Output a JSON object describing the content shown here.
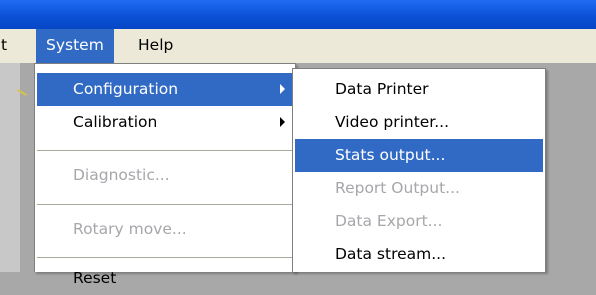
{
  "menubar": {
    "items": [
      {
        "label": "t"
      },
      {
        "label": "System"
      },
      {
        "label": "Help"
      }
    ]
  },
  "system_menu": {
    "items": [
      {
        "label": "Configuration",
        "has_submenu": true,
        "state": "highlighted"
      },
      {
        "label": "Calibration",
        "has_submenu": true,
        "state": "normal"
      },
      {
        "label": "Diagnostic...",
        "state": "disabled"
      },
      {
        "label": "Rotary move...",
        "state": "disabled"
      },
      {
        "label": "Reset",
        "state": "normal"
      }
    ]
  },
  "configuration_submenu": {
    "items": [
      {
        "label": "Data Printer",
        "state": "normal"
      },
      {
        "label": "Video printer...",
        "state": "normal"
      },
      {
        "label": "Stats output...",
        "state": "highlighted"
      },
      {
        "label": "Report Output...",
        "state": "disabled"
      },
      {
        "label": "Data Export...",
        "state": "disabled"
      },
      {
        "label": "Data stream...",
        "state": "normal"
      }
    ]
  },
  "colors": {
    "highlight": "#316ac5",
    "disabled_text": "#a7a6aa",
    "titlebar": "#0a4fd4",
    "menubar": "#ece9d8"
  }
}
